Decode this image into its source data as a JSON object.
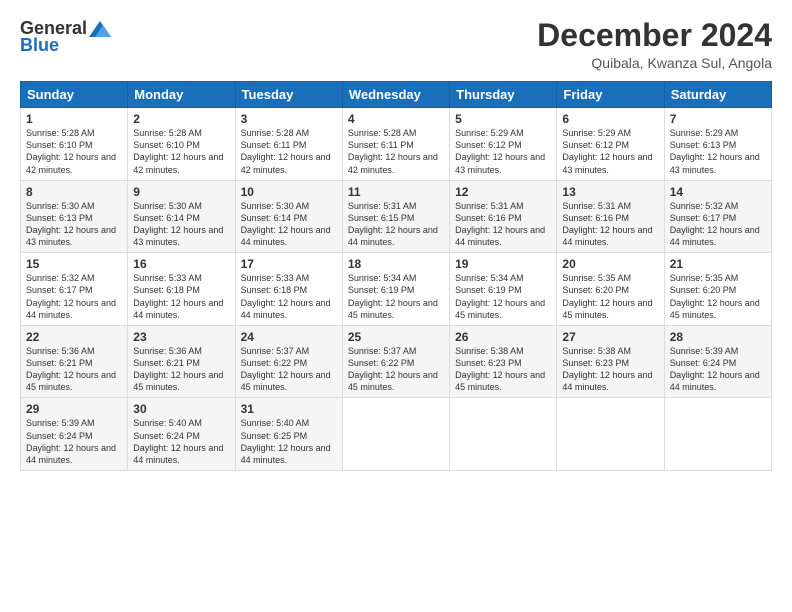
{
  "logo": {
    "general": "General",
    "blue": "Blue"
  },
  "header": {
    "month": "December 2024",
    "location": "Quibala, Kwanza Sul, Angola"
  },
  "weekdays": [
    "Sunday",
    "Monday",
    "Tuesday",
    "Wednesday",
    "Thursday",
    "Friday",
    "Saturday"
  ],
  "weeks": [
    [
      {
        "day": "1",
        "sunrise": "Sunrise: 5:28 AM",
        "sunset": "Sunset: 6:10 PM",
        "daylight": "Daylight: 12 hours and 42 minutes."
      },
      {
        "day": "2",
        "sunrise": "Sunrise: 5:28 AM",
        "sunset": "Sunset: 6:10 PM",
        "daylight": "Daylight: 12 hours and 42 minutes."
      },
      {
        "day": "3",
        "sunrise": "Sunrise: 5:28 AM",
        "sunset": "Sunset: 6:11 PM",
        "daylight": "Daylight: 12 hours and 42 minutes."
      },
      {
        "day": "4",
        "sunrise": "Sunrise: 5:28 AM",
        "sunset": "Sunset: 6:11 PM",
        "daylight": "Daylight: 12 hours and 42 minutes."
      },
      {
        "day": "5",
        "sunrise": "Sunrise: 5:29 AM",
        "sunset": "Sunset: 6:12 PM",
        "daylight": "Daylight: 12 hours and 43 minutes."
      },
      {
        "day": "6",
        "sunrise": "Sunrise: 5:29 AM",
        "sunset": "Sunset: 6:12 PM",
        "daylight": "Daylight: 12 hours and 43 minutes."
      },
      {
        "day": "7",
        "sunrise": "Sunrise: 5:29 AM",
        "sunset": "Sunset: 6:13 PM",
        "daylight": "Daylight: 12 hours and 43 minutes."
      }
    ],
    [
      {
        "day": "8",
        "sunrise": "Sunrise: 5:30 AM",
        "sunset": "Sunset: 6:13 PM",
        "daylight": "Daylight: 12 hours and 43 minutes."
      },
      {
        "day": "9",
        "sunrise": "Sunrise: 5:30 AM",
        "sunset": "Sunset: 6:14 PM",
        "daylight": "Daylight: 12 hours and 43 minutes."
      },
      {
        "day": "10",
        "sunrise": "Sunrise: 5:30 AM",
        "sunset": "Sunset: 6:14 PM",
        "daylight": "Daylight: 12 hours and 44 minutes."
      },
      {
        "day": "11",
        "sunrise": "Sunrise: 5:31 AM",
        "sunset": "Sunset: 6:15 PM",
        "daylight": "Daylight: 12 hours and 44 minutes."
      },
      {
        "day": "12",
        "sunrise": "Sunrise: 5:31 AM",
        "sunset": "Sunset: 6:16 PM",
        "daylight": "Daylight: 12 hours and 44 minutes."
      },
      {
        "day": "13",
        "sunrise": "Sunrise: 5:31 AM",
        "sunset": "Sunset: 6:16 PM",
        "daylight": "Daylight: 12 hours and 44 minutes."
      },
      {
        "day": "14",
        "sunrise": "Sunrise: 5:32 AM",
        "sunset": "Sunset: 6:17 PM",
        "daylight": "Daylight: 12 hours and 44 minutes."
      }
    ],
    [
      {
        "day": "15",
        "sunrise": "Sunrise: 5:32 AM",
        "sunset": "Sunset: 6:17 PM",
        "daylight": "Daylight: 12 hours and 44 minutes."
      },
      {
        "day": "16",
        "sunrise": "Sunrise: 5:33 AM",
        "sunset": "Sunset: 6:18 PM",
        "daylight": "Daylight: 12 hours and 44 minutes."
      },
      {
        "day": "17",
        "sunrise": "Sunrise: 5:33 AM",
        "sunset": "Sunset: 6:18 PM",
        "daylight": "Daylight: 12 hours and 44 minutes."
      },
      {
        "day": "18",
        "sunrise": "Sunrise: 5:34 AM",
        "sunset": "Sunset: 6:19 PM",
        "daylight": "Daylight: 12 hours and 45 minutes."
      },
      {
        "day": "19",
        "sunrise": "Sunrise: 5:34 AM",
        "sunset": "Sunset: 6:19 PM",
        "daylight": "Daylight: 12 hours and 45 minutes."
      },
      {
        "day": "20",
        "sunrise": "Sunrise: 5:35 AM",
        "sunset": "Sunset: 6:20 PM",
        "daylight": "Daylight: 12 hours and 45 minutes."
      },
      {
        "day": "21",
        "sunrise": "Sunrise: 5:35 AM",
        "sunset": "Sunset: 6:20 PM",
        "daylight": "Daylight: 12 hours and 45 minutes."
      }
    ],
    [
      {
        "day": "22",
        "sunrise": "Sunrise: 5:36 AM",
        "sunset": "Sunset: 6:21 PM",
        "daylight": "Daylight: 12 hours and 45 minutes."
      },
      {
        "day": "23",
        "sunrise": "Sunrise: 5:36 AM",
        "sunset": "Sunset: 6:21 PM",
        "daylight": "Daylight: 12 hours and 45 minutes."
      },
      {
        "day": "24",
        "sunrise": "Sunrise: 5:37 AM",
        "sunset": "Sunset: 6:22 PM",
        "daylight": "Daylight: 12 hours and 45 minutes."
      },
      {
        "day": "25",
        "sunrise": "Sunrise: 5:37 AM",
        "sunset": "Sunset: 6:22 PM",
        "daylight": "Daylight: 12 hours and 45 minutes."
      },
      {
        "day": "26",
        "sunrise": "Sunrise: 5:38 AM",
        "sunset": "Sunset: 6:23 PM",
        "daylight": "Daylight: 12 hours and 45 minutes."
      },
      {
        "day": "27",
        "sunrise": "Sunrise: 5:38 AM",
        "sunset": "Sunset: 6:23 PM",
        "daylight": "Daylight: 12 hours and 44 minutes."
      },
      {
        "day": "28",
        "sunrise": "Sunrise: 5:39 AM",
        "sunset": "Sunset: 6:24 PM",
        "daylight": "Daylight: 12 hours and 44 minutes."
      }
    ],
    [
      {
        "day": "29",
        "sunrise": "Sunrise: 5:39 AM",
        "sunset": "Sunset: 6:24 PM",
        "daylight": "Daylight: 12 hours and 44 minutes."
      },
      {
        "day": "30",
        "sunrise": "Sunrise: 5:40 AM",
        "sunset": "Sunset: 6:24 PM",
        "daylight": "Daylight: 12 hours and 44 minutes."
      },
      {
        "day": "31",
        "sunrise": "Sunrise: 5:40 AM",
        "sunset": "Sunset: 6:25 PM",
        "daylight": "Daylight: 12 hours and 44 minutes."
      },
      null,
      null,
      null,
      null
    ]
  ]
}
